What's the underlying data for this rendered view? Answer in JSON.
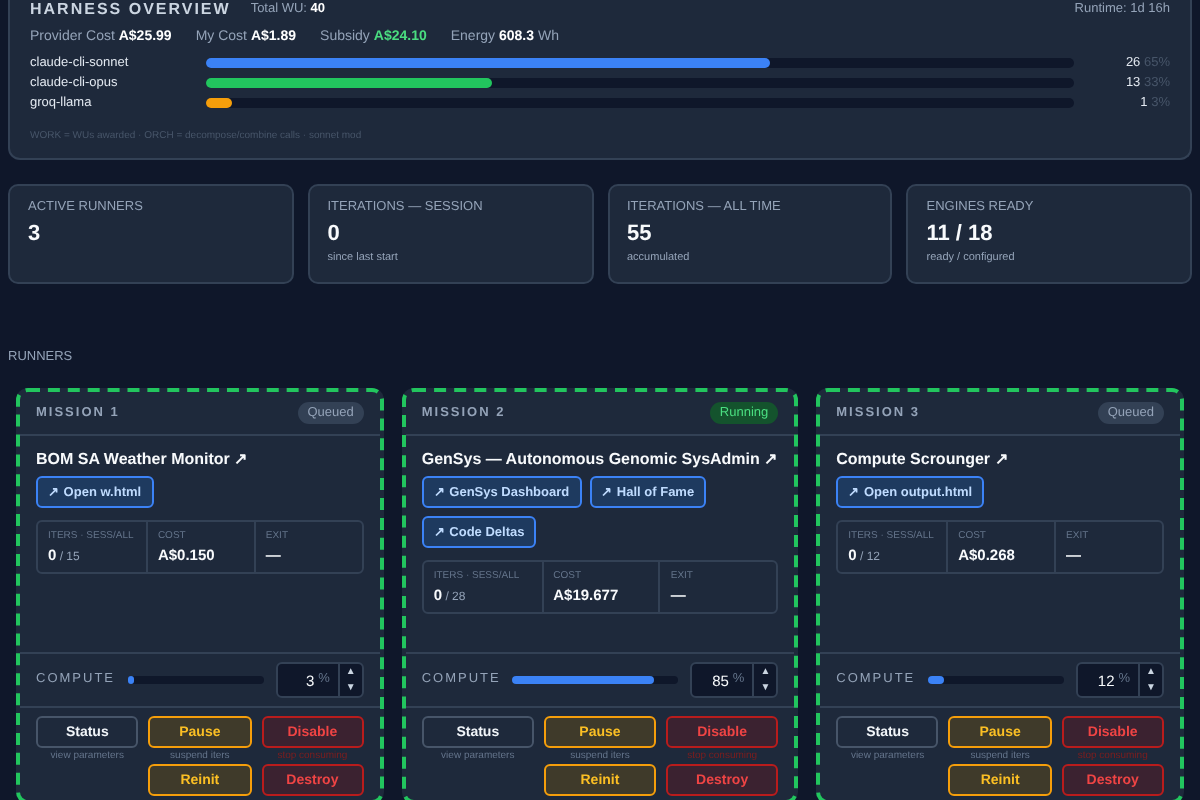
{
  "overview": {
    "title": "HARNESS OVERVIEW",
    "total_label": "Total WU:",
    "total_value": "40",
    "runtime": "Runtime: 1d 16h",
    "costs": [
      {
        "label": "Provider Cost",
        "value": "A$25.99",
        "kind": "plain"
      },
      {
        "label": "My Cost",
        "value": "A$1.89",
        "kind": "plain"
      },
      {
        "label": "Subsidy",
        "value": "A$24.10",
        "kind": "good"
      },
      {
        "label": "Energy",
        "value": "608.3",
        "unit": "Wh",
        "kind": "plain"
      }
    ],
    "models": [
      {
        "name": "claude-cli-sonnet",
        "level": 0.65,
        "count": "26",
        "pct": "65%",
        "color": "#3b82f6"
      },
      {
        "name": "claude-cli-opus",
        "level": 0.33,
        "count": "13",
        "pct": "33%",
        "color": "#22c55e"
      },
      {
        "name": "groq-llama",
        "level": 0.03,
        "count": "1",
        "pct": "3%",
        "color": "#f59e0b"
      }
    ],
    "legend": "WORK = WUs awarded · ORCH = decompose/combine calls · sonnet mod"
  },
  "stats": [
    {
      "label": "ACTIVE RUNNERS",
      "value": "3"
    },
    {
      "label": "ITERATIONS — SESSION",
      "value": "0",
      "note": "since last start"
    },
    {
      "label": "ITERATIONS — ALL TIME",
      "value": "55",
      "note": "accumulated"
    },
    {
      "label": "ENGINES READY",
      "value": "11 / 18",
      "note": "ready / configured"
    }
  ],
  "runners_title": "RUNNERS",
  "missions": [
    {
      "label": "MISSION 1",
      "status": "Queued",
      "kind": "queued",
      "title": "BOM SA Weather Monitor ↗",
      "links": [
        "↗ Open w.html"
      ],
      "fields": [
        {
          "label": "ITERS · SESS/ALL",
          "value": "0",
          "extra": "/ 15"
        },
        {
          "label": "COST",
          "value": "A$0.150"
        },
        {
          "label": "EXIT",
          "value": "—"
        }
      ],
      "compute_label": "COMPUTE",
      "compute": "3",
      "unit": "%",
      "up": "▲",
      "down": "▼",
      "level": 0.03,
      "actions": [
        {
          "label": "Status",
          "note": "view parameters",
          "kind": "neutral"
        },
        {
          "label": "Pause",
          "note": "suspend iters",
          "kind": "warn"
        },
        {
          "label": "Disable",
          "note": "stop consuming",
          "kind": "danger"
        },
        {
          "label": "Reinit",
          "kind": "warn"
        },
        {
          "label": "Destroy",
          "kind": "danger"
        }
      ]
    },
    {
      "label": "MISSION 2",
      "status": "Running",
      "kind": "running",
      "title": "GenSys — Autonomous Genomic SysAdmin ↗",
      "links": [
        "↗ GenSys Dashboard",
        "↗ Hall of Fame",
        "↗ Code Deltas"
      ],
      "fields": [
        {
          "label": "ITERS · SESS/ALL",
          "value": "0",
          "extra": "/ 28"
        },
        {
          "label": "COST",
          "value": "A$19.677"
        },
        {
          "label": "EXIT",
          "value": "—"
        }
      ],
      "compute_label": "COMPUTE",
      "compute": "85",
      "unit": "%",
      "up": "▲",
      "down": "▼",
      "level": 0.85,
      "actions": [
        {
          "label": "Status",
          "note": "view parameters",
          "kind": "neutral"
        },
        {
          "label": "Pause",
          "note": "suspend iters",
          "kind": "warn"
        },
        {
          "label": "Disable",
          "note": "stop consuming",
          "kind": "danger"
        },
        {
          "label": "Reinit",
          "kind": "warn"
        },
        {
          "label": "Destroy",
          "kind": "danger"
        }
      ]
    },
    {
      "label": "MISSION 3",
      "status": "Queued",
      "kind": "queued",
      "title": "Compute Scrounger ↗",
      "links": [
        "↗ Open output.html"
      ],
      "fields": [
        {
          "label": "ITERS · SESS/ALL",
          "value": "0",
          "extra": "/ 12"
        },
        {
          "label": "COST",
          "value": "A$0.268"
        },
        {
          "label": "EXIT",
          "value": "—"
        }
      ],
      "compute_label": "COMPUTE",
      "compute": "12",
      "unit": "%",
      "up": "▲",
      "down": "▼",
      "level": 0.12,
      "actions": [
        {
          "label": "Status",
          "note": "view parameters",
          "kind": "neutral"
        },
        {
          "label": "Pause",
          "note": "suspend iters",
          "kind": "warn"
        },
        {
          "label": "Disable",
          "note": "stop consuming",
          "kind": "danger"
        },
        {
          "label": "Reinit",
          "kind": "warn"
        },
        {
          "label": "Destroy",
          "kind": "danger"
        }
      ]
    }
  ]
}
